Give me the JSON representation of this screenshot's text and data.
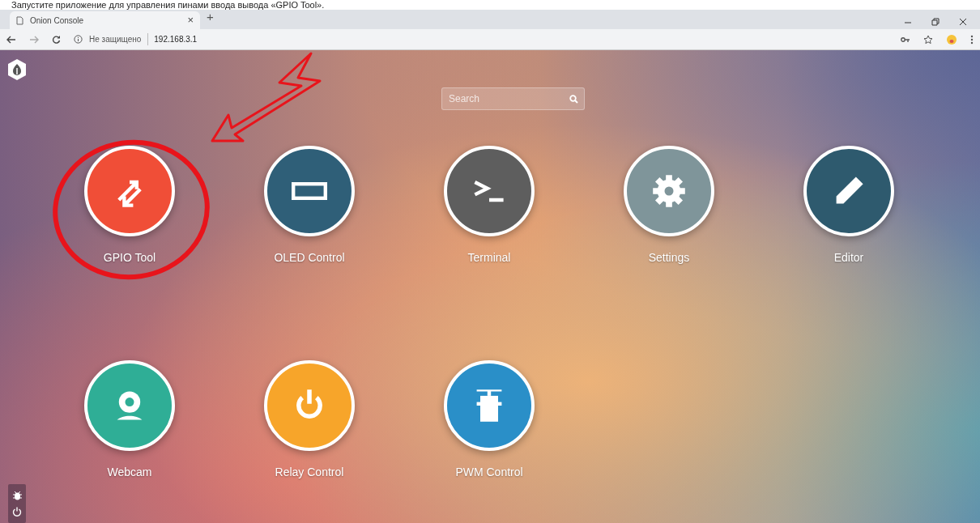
{
  "caption": "Запустите приложение для управления пинами ввода вывода «GPIO Tool».",
  "browser": {
    "tab_title": "Onion Console",
    "tab_close": "×",
    "new_tab": "+",
    "security": "Не защищено",
    "url": "192.168.3.1"
  },
  "search": {
    "placeholder": "Search"
  },
  "apps": [
    {
      "label": "GPIO Tool",
      "kind": "gpio",
      "color": "#f04e37"
    },
    {
      "label": "OLED Control",
      "kind": "oled",
      "color": "#2f5f78"
    },
    {
      "label": "Terminal",
      "kind": "terminal",
      "color": "#5e5e5e"
    },
    {
      "label": "Settings",
      "kind": "settings",
      "color": "#7f959a"
    },
    {
      "label": "Editor",
      "kind": "editor",
      "color": "#2e5a6e"
    },
    {
      "label": "Webcam",
      "kind": "webcam",
      "color": "#2fae96"
    },
    {
      "label": "Relay Control",
      "kind": "relay",
      "color": "#f7a52a"
    },
    {
      "label": "PWM Control",
      "kind": "pwm",
      "color": "#2a8fc8"
    }
  ]
}
